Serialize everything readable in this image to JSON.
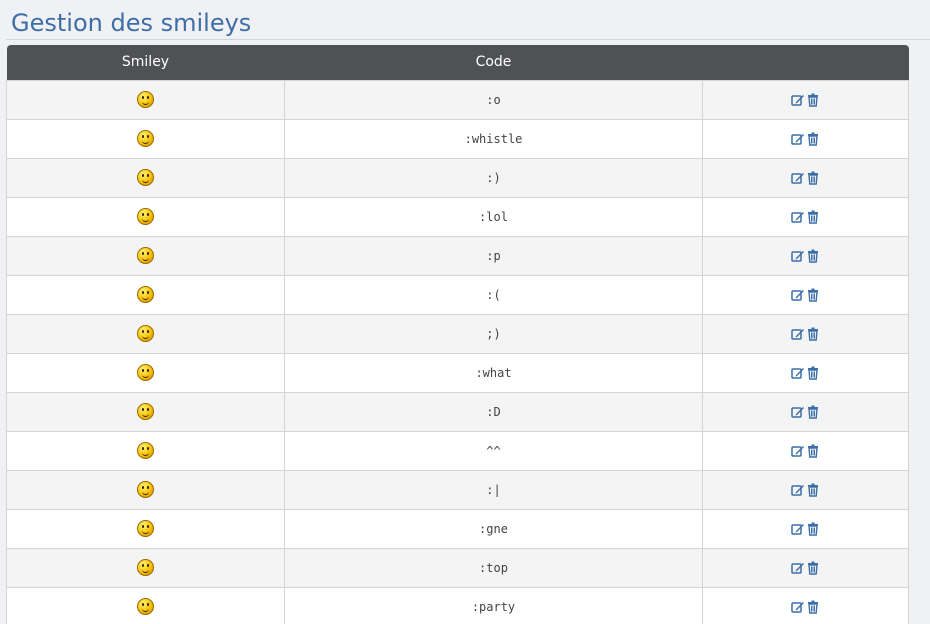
{
  "page": {
    "title": "Gestion des smileys"
  },
  "table": {
    "headers": {
      "smiley": "Smiley",
      "code": "Code",
      "actions": ""
    },
    "rows": [
      {
        "code": ":o",
        "icon": "surprised-smiley-icon"
      },
      {
        "code": ":whistle",
        "icon": "whistle-smiley-icon"
      },
      {
        "code": ":)",
        "icon": "smile-smiley-icon"
      },
      {
        "code": ":lol",
        "icon": "laugh-smiley-icon"
      },
      {
        "code": ":p",
        "icon": "tongue-smiley-icon"
      },
      {
        "code": ":(",
        "icon": "sad-smiley-icon"
      },
      {
        "code": ";)",
        "icon": "wink-smiley-icon"
      },
      {
        "code": ":what",
        "icon": "what-smiley-icon"
      },
      {
        "code": ":D",
        "icon": "grin-smiley-icon"
      },
      {
        "code": "^^",
        "icon": "happy-smiley-icon"
      },
      {
        "code": ":|",
        "icon": "neutral-smiley-icon"
      },
      {
        "code": ":gne",
        "icon": "gne-smiley-icon"
      },
      {
        "code": ":top",
        "icon": "top-smiley-icon"
      },
      {
        "code": ":party",
        "icon": "party-smiley-icon"
      }
    ],
    "row_actions": [
      "edit-icon",
      "delete-icon"
    ]
  },
  "colors": {
    "title": "#3f6ea6",
    "header_bg": "#4f5155",
    "icon_blue": "#3b6fa8"
  }
}
